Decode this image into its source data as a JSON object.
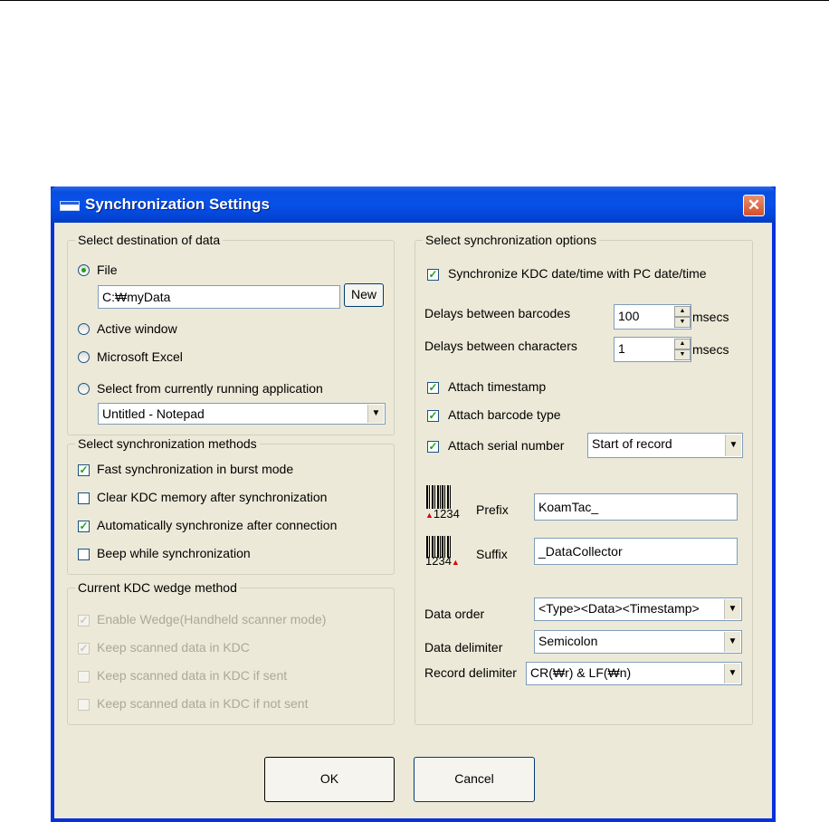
{
  "window": {
    "title": "Synchronization Settings",
    "close_glyph": "✕"
  },
  "destination": {
    "legend": "Select destination of data",
    "file_label": "File",
    "file_path": "C:₩myData",
    "new_button": "New",
    "active_window": "Active window",
    "excel": "Microsoft Excel",
    "running_app": "Select from currently running application",
    "app_selected": "Untitled - Notepad",
    "selected": "file"
  },
  "methods": {
    "legend": "Select synchronization methods",
    "items": [
      {
        "label": "Fast synchronization in burst mode",
        "checked": true
      },
      {
        "label": "Clear KDC memory after synchronization",
        "checked": false
      },
      {
        "label": "Automatically synchronize after connection",
        "checked": true
      },
      {
        "label": "Beep while synchronization",
        "checked": false
      }
    ]
  },
  "wedge": {
    "legend": "Current KDC wedge method",
    "items": [
      {
        "label": "Enable Wedge(Handheld scanner mode)",
        "checked": true
      },
      {
        "label": "Keep scanned data in KDC",
        "checked": true
      },
      {
        "label": "Keep scanned data in KDC if sent",
        "checked": false
      },
      {
        "label": "Keep scanned data in KDC if not sent",
        "checked": false
      }
    ]
  },
  "options": {
    "legend": "Select synchronization options",
    "sync_datetime": "Synchronize KDC date/time with PC date/time",
    "delay_barcodes_label": "Delays between barcodes",
    "delay_barcodes_value": "100",
    "delay_chars_label": "Delays between characters",
    "delay_chars_value": "1",
    "unit": "msecs",
    "attach_timestamp": "Attach timestamp",
    "attach_barcode_type": "Attach barcode type",
    "attach_serial": "Attach serial number",
    "serial_position": "Start of record",
    "prefix_label": "Prefix",
    "prefix_value": "KoamTac_",
    "suffix_label": "Suffix",
    "suffix_value": "_DataCollector",
    "barcode_digits": "1234",
    "data_order_label": "Data order",
    "data_order_value": "<Type><Data><Timestamp>",
    "data_delimiter_label": "Data delimiter",
    "data_delimiter_value": "Semicolon",
    "record_delimiter_label": "Record delimiter",
    "record_delimiter_value": "CR(₩r) & LF(₩n)"
  },
  "buttons": {
    "ok": "OK",
    "cancel": "Cancel"
  },
  "colors": {
    "title_bar": "#0a4ee0",
    "face": "#ece9d8",
    "check": "#21a121",
    "close": "#d4502a",
    "barcode_arrow": "#e00000"
  }
}
